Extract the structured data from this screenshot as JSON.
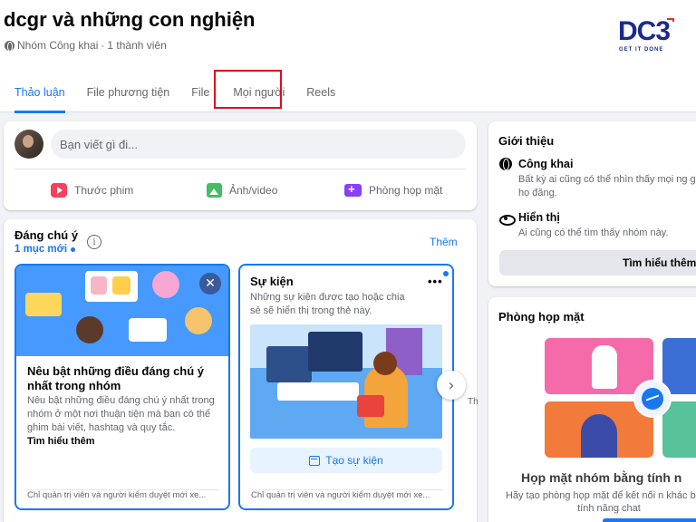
{
  "group": {
    "name": "dcgr và những con nghiện",
    "privacy": "Nhóm Công khai",
    "separator": "·",
    "members": "1 thành viên"
  },
  "logo": {
    "text": "DC",
    "digit": "3",
    "tagline": "GET IT DONE"
  },
  "tabs": [
    {
      "label": "Thảo luận",
      "active": true
    },
    {
      "label": "File phương tiện"
    },
    {
      "label": "File"
    },
    {
      "label": "Mọi người",
      "highlighted": true
    },
    {
      "label": "Reels"
    }
  ],
  "composer": {
    "placeholder": "Bạn viết gì đi...",
    "actions": [
      {
        "label": "Thước phim",
        "icon": "reel-icon"
      },
      {
        "label": "Ảnh/video",
        "icon": "photo-icon"
      },
      {
        "label": "Phòng họp mặt",
        "icon": "room-icon"
      }
    ]
  },
  "featured": {
    "title": "Đáng chú ý",
    "new_count": "1 mục mới",
    "more": "Thêm",
    "cards": [
      {
        "heading": "Nêu bật những điều đáng chú ý nhất trong nhóm",
        "body": "Nêu bật những điều đáng chú ý nhất trong nhóm ở một nơi thuận tiện mà bạn có thể ghim bài viết, hashtag và quy tắc.",
        "link": "Tìm hiểu thêm",
        "footer": "Chỉ quản trị viên và người kiểm duyệt mới xe..."
      },
      {
        "heading": "Sự kiện",
        "body": "Những sự kiện được tạo hoặc chia sẻ sẽ hiển thị trong thẻ này.",
        "button": "Tạo sự kiện",
        "footer": "Chỉ quản trị viên và người kiểm duyệt mới xe..."
      }
    ],
    "peek": "Th"
  },
  "about": {
    "title": "Giới thiệu",
    "public_head": "Công khai",
    "public_desc": "Bất kỳ ai cũng có thể nhìn thấy mọi ng gì họ đăng.",
    "visible_head": "Hiển thị",
    "visible_desc": "Ai cũng có thể tìm thấy nhóm này.",
    "learn_more": "Tìm hiểu thêm"
  },
  "rooms": {
    "title": "Phòng họp mặt",
    "heading": "Họp mặt nhóm bằng tính n",
    "desc": "Hãy tạo phòng họp mặt để kết nối n khác bằng tính năng chat"
  },
  "colors": {
    "accent": "#1877f2",
    "highlight_box": "#e00b1c",
    "background": "#f0f2f5"
  }
}
